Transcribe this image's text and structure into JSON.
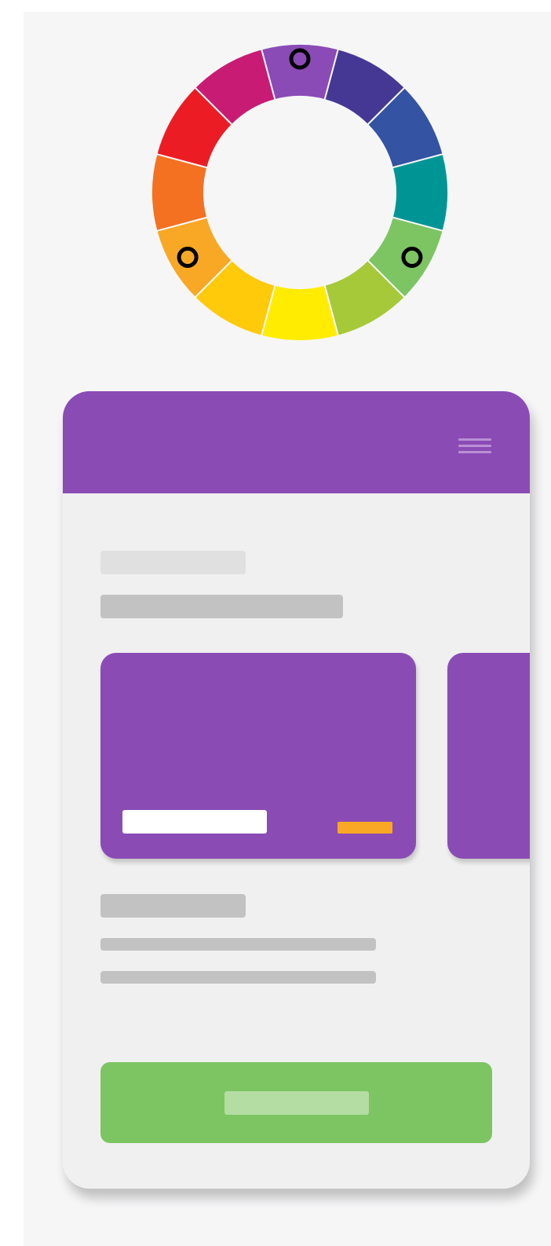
{
  "color_wheel": {
    "segments": [
      {
        "name": "violet",
        "color": "#8a4bb6"
      },
      {
        "name": "indigo",
        "color": "#453894"
      },
      {
        "name": "blue",
        "color": "#3453a3"
      },
      {
        "name": "teal",
        "color": "#009595"
      },
      {
        "name": "green",
        "color": "#7dc462"
      },
      {
        "name": "yellow-green",
        "color": "#a6c939"
      },
      {
        "name": "yellow",
        "color": "#ffec00"
      },
      {
        "name": "yellow-orange",
        "color": "#ffca09"
      },
      {
        "name": "orange-yellow",
        "color": "#f9a825"
      },
      {
        "name": "orange",
        "color": "#f37121"
      },
      {
        "name": "red",
        "color": "#ec1c24"
      },
      {
        "name": "magenta",
        "color": "#c81c74"
      }
    ],
    "selected_markers": [
      "violet",
      "green",
      "orange-yellow"
    ],
    "scheme": "triadic"
  },
  "mockup": {
    "header_color": "#8b4bb5",
    "body_color": "#f0f0f1",
    "menu_icon": "hamburger-icon",
    "card_color": "#8b4bb5",
    "card_accent_color": "#f9a825",
    "cta_color": "#7dc462"
  }
}
